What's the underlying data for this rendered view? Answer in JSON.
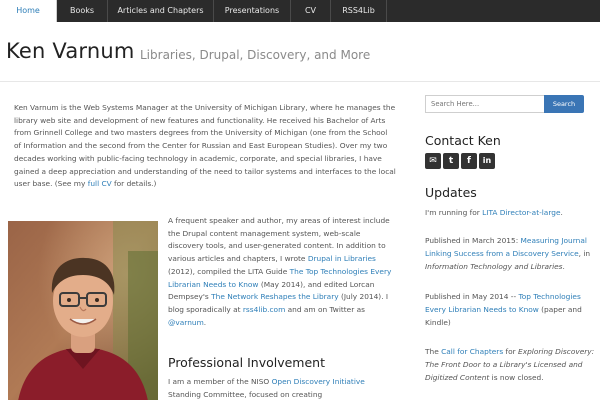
{
  "nav": {
    "items": [
      {
        "label": "Home",
        "active": true
      },
      {
        "label": "Books"
      },
      {
        "label": "Articles and Chapters"
      },
      {
        "label": "Presentations"
      },
      {
        "label": "CV"
      },
      {
        "label": "RSS4Lib"
      }
    ]
  },
  "header": {
    "title": "Ken Varnum",
    "tagline": "Libraries, Drupal, Discovery, and More"
  },
  "intro": {
    "text": "Ken Varnum is the Web Systems Manager at the University of Michigan Library, where he manages the library web site and development of new features and functionality. He received his Bachelor of Arts from Grinnell College and two masters degrees from the University of Michigan (one from the School of Information and the second from the Center for Russian and East European Studies). Over my two decades working with public-facing technology in academic, corporate, and special libraries, I have gained a deep appreciation and understanding of the need to tailor systems and interfaces to the local user base. (See my ",
    "cv_link": "full CV",
    "after": " for details.)"
  },
  "bio": {
    "p1": "A frequent speaker and author, my areas of interest include the Drupal content management system, web-scale discovery tools, and user-generated content. In addition to various articles and chapters, I wrote ",
    "link1": "Drupal in Libraries",
    "p2": " (2012), compiled the LITA Guide ",
    "link2": "The Top Technologies Every Librarian Needs to Know",
    "p3": " (May 2014), and edited Lorcan Dempsey's ",
    "link3": "The Network Reshapes the Library",
    "p4": " (July 2014). I blog sporadically at ",
    "link4": "rss4lib.com",
    "p5": " and am on Twitter as ",
    "link5": "@varnum",
    "p6": "."
  },
  "professional": {
    "title": "Professional Involvement",
    "p1": "I am a member of the NISO ",
    "link1": "Open Discovery Initiative",
    "p2": " Standing Committee, focused on creating"
  },
  "sidebar": {
    "search_placeholder": "Search Here...",
    "search_button": "Search",
    "contact_title": "Contact Ken",
    "social": [
      {
        "icon": "email-icon",
        "glyph": "✉"
      },
      {
        "icon": "twitter-icon",
        "glyph": "t"
      },
      {
        "icon": "facebook-icon",
        "glyph": "f"
      },
      {
        "icon": "linkedin-icon",
        "glyph": "in"
      }
    ],
    "updates_title": "Updates",
    "updates": {
      "u1_pre": "I'm running for ",
      "u1_link": "LITA Director-at-large",
      "u1_post": ".",
      "u2_pre": "Published in March 2015: ",
      "u2_link": "Measuring Journal Linking Success from a Discovery Service",
      "u2_mid": ", in ",
      "u2_italic": "Information Technology and Libraries",
      "u2_post": ".",
      "u3_pre": "Published in May 2014 -- ",
      "u3_link": "Top Technologies Every Librarian Needs to Know",
      "u3_post": " (paper and Kindle)",
      "u4_pre": "The ",
      "u4_link": "Call for Chapters",
      "u4_mid": " for ",
      "u4_italic": "Exploring Discovery: The Front Door to a Library's Licensed and Digitized Content",
      "u4_post": " is now closed."
    }
  },
  "colors": {
    "nav_bg": "#2b2b2b",
    "link": "#2f7fb8",
    "search_button": "#3a75b5"
  }
}
